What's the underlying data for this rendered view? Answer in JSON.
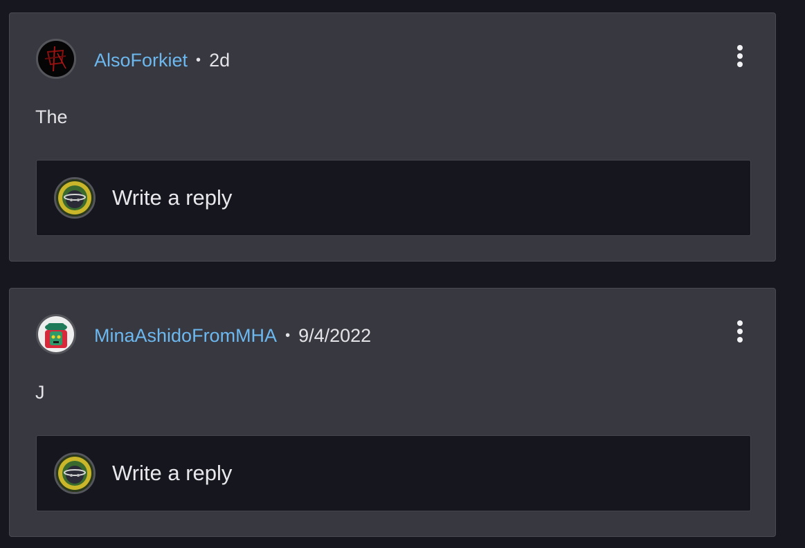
{
  "comments": [
    {
      "username": "AlsoForkiet",
      "separator": "•",
      "timestamp": "2d",
      "body": "The",
      "reply_placeholder": "Write a reply",
      "avatar_icon": "dark-red-scribble-avatar"
    },
    {
      "username": "MinaAshidoFromMHA",
      "separator": "•",
      "timestamp": "9/4/2022",
      "body": "J",
      "reply_placeholder": "Write a reply",
      "avatar_icon": "green-hat-character-avatar"
    }
  ],
  "current_user_avatar_icon": "yellow-green-ring-avatar",
  "colors": {
    "background": "#17171f",
    "card": "#383841",
    "reply_box": "#16161e",
    "username": "#6cb8ef",
    "text": "#e4e4e8"
  }
}
